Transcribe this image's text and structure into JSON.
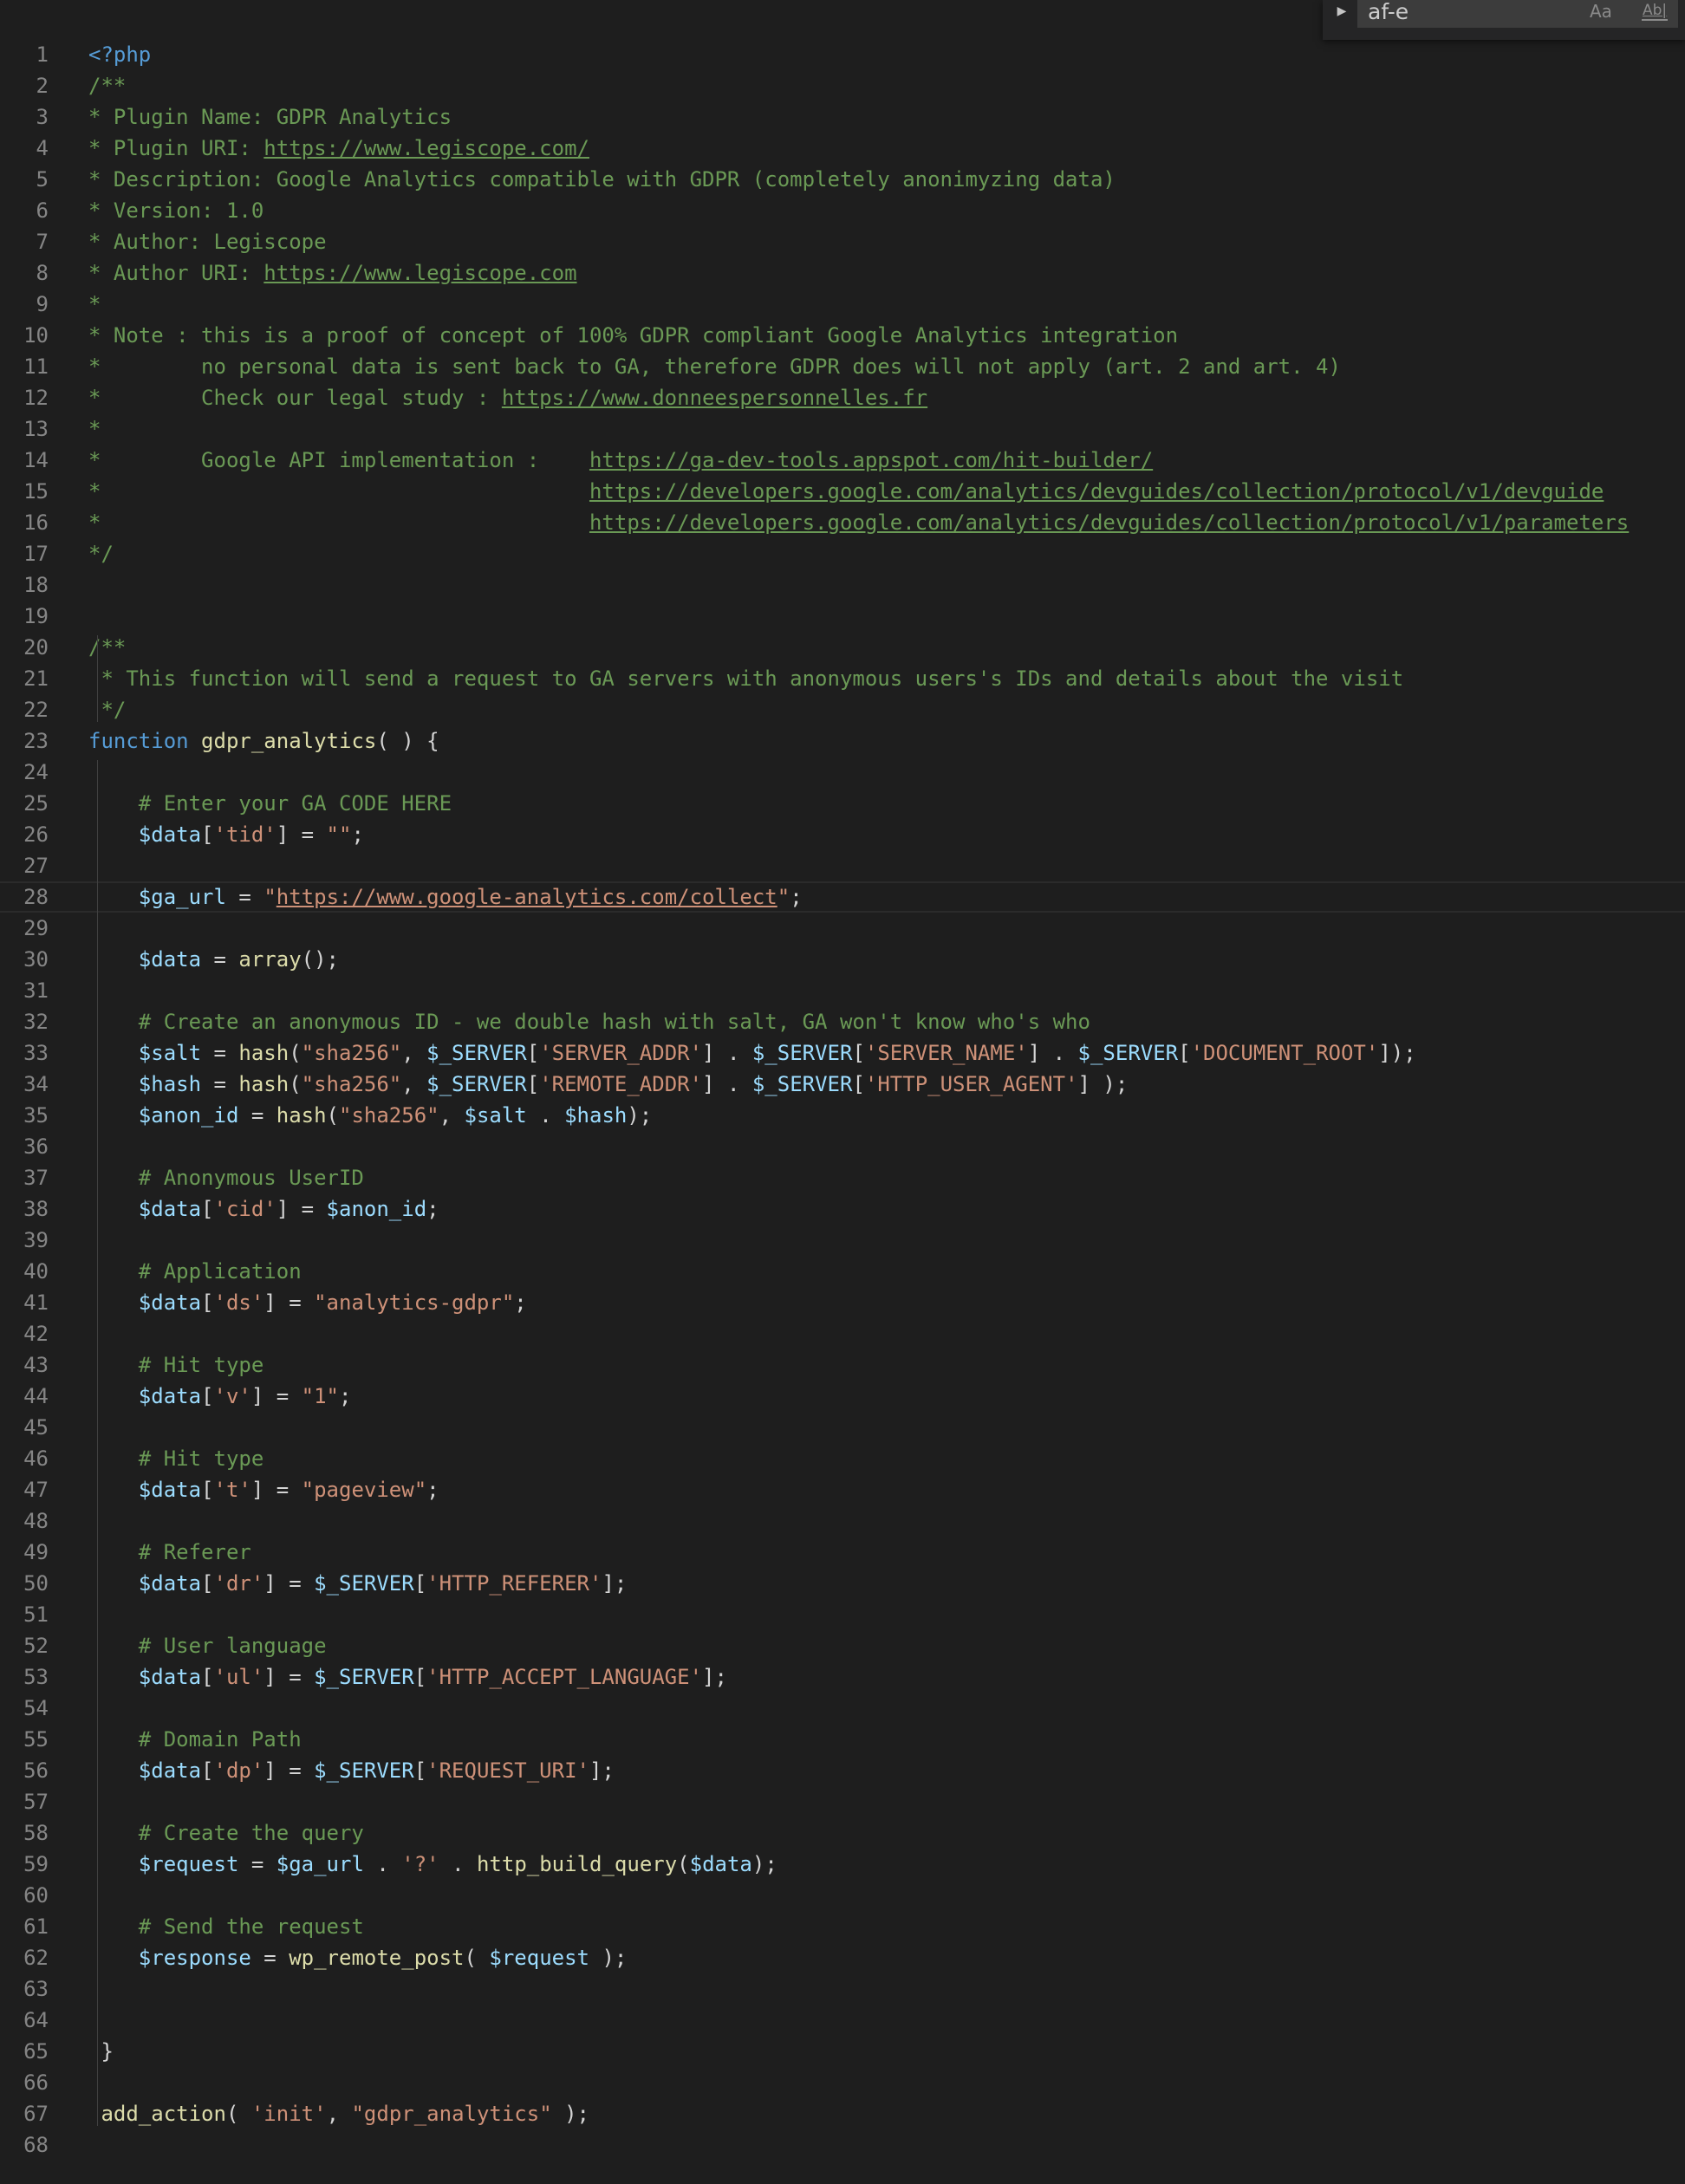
{
  "editor": {
    "language": "php",
    "current_line": 28,
    "lines": [
      [
        [
          "t-keyword",
          "<?php"
        ]
      ],
      [
        [
          "t-comment",
          "/**"
        ]
      ],
      [
        [
          "t-comment",
          "* Plugin Name: GDPR Analytics"
        ]
      ],
      [
        [
          "t-comment",
          "* Plugin URI: "
        ],
        [
          "t-comment t-link",
          "https://www.legiscope.com/"
        ]
      ],
      [
        [
          "t-comment",
          "* Description: Google Analytics compatible with GDPR (completely anonimyzing data)"
        ]
      ],
      [
        [
          "t-comment",
          "* Version: 1.0"
        ]
      ],
      [
        [
          "t-comment",
          "* Author: Legiscope"
        ]
      ],
      [
        [
          "t-comment",
          "* Author URI: "
        ],
        [
          "t-comment t-link",
          "https://www.legiscope.com"
        ]
      ],
      [
        [
          "t-comment",
          "*"
        ]
      ],
      [
        [
          "t-comment",
          "* Note : this is a proof of concept of 100% GDPR compliant Google Analytics integration"
        ]
      ],
      [
        [
          "t-comment",
          "*        no personal data is sent back to GA, therefore GDPR does will not apply (art. 2 and art. 4)"
        ]
      ],
      [
        [
          "t-comment",
          "*        Check our legal study : "
        ],
        [
          "t-comment t-link",
          "https://www.donneespersonnelles.fr"
        ]
      ],
      [
        [
          "t-comment",
          "*"
        ]
      ],
      [
        [
          "t-comment",
          "*        Google API implementation :    "
        ],
        [
          "t-comment t-link",
          "https://ga-dev-tools.appspot.com/hit-builder/"
        ]
      ],
      [
        [
          "t-comment",
          "*                                       "
        ],
        [
          "t-comment t-link",
          "https://developers.google.com/analytics/devguides/collection/protocol/v1/devguide"
        ]
      ],
      [
        [
          "t-comment",
          "*                                       "
        ],
        [
          "t-comment t-link",
          "https://developers.google.com/analytics/devguides/collection/protocol/v1/parameters"
        ]
      ],
      [
        [
          "t-comment",
          "*/"
        ]
      ],
      [],
      [],
      [
        [
          "t-comment",
          "/**"
        ]
      ],
      [
        [
          "t-comment",
          " * This function will send a request to GA servers with anonymous users's IDs and details about the visit"
        ]
      ],
      [
        [
          "t-comment",
          " */"
        ]
      ],
      [
        [
          "t-keyword",
          "function "
        ],
        [
          "t-func",
          "gdpr_analytics"
        ],
        [
          "t-plain",
          "( ) {"
        ]
      ],
      [],
      [
        [
          "t-plain",
          "    "
        ],
        [
          "t-comment",
          "# Enter your GA CODE HERE"
        ]
      ],
      [
        [
          "t-plain",
          "    "
        ],
        [
          "t-var",
          "$data"
        ],
        [
          "t-plain",
          "["
        ],
        [
          "t-string",
          "'tid'"
        ],
        [
          "t-plain",
          "] = "
        ],
        [
          "t-string",
          "\"\""
        ],
        [
          "t-plain",
          ";"
        ]
      ],
      [],
      [
        [
          "t-plain",
          "    "
        ],
        [
          "t-var",
          "$ga_url"
        ],
        [
          "t-plain",
          " = "
        ],
        [
          "t-string",
          "\""
        ],
        [
          "t-string t-link",
          "https://www.google-analytics.com/collect"
        ],
        [
          "t-string",
          "\""
        ],
        [
          "t-plain",
          ";"
        ]
      ],
      [],
      [
        [
          "t-plain",
          "    "
        ],
        [
          "t-var",
          "$data"
        ],
        [
          "t-plain",
          " = "
        ],
        [
          "t-func",
          "array"
        ],
        [
          "t-plain",
          "();"
        ]
      ],
      [],
      [
        [
          "t-plain",
          "    "
        ],
        [
          "t-comment",
          "# Create an anonymous ID - we double hash with salt, GA won't know who's who"
        ]
      ],
      [
        [
          "t-plain",
          "    "
        ],
        [
          "t-var",
          "$salt"
        ],
        [
          "t-plain",
          " = "
        ],
        [
          "t-func",
          "hash"
        ],
        [
          "t-plain",
          "("
        ],
        [
          "t-string",
          "\"sha256\""
        ],
        [
          "t-plain",
          ", "
        ],
        [
          "t-var",
          "$_SERVER"
        ],
        [
          "t-plain",
          "["
        ],
        [
          "t-string",
          "'SERVER_ADDR'"
        ],
        [
          "t-plain",
          "] . "
        ],
        [
          "t-var",
          "$_SERVER"
        ],
        [
          "t-plain",
          "["
        ],
        [
          "t-string",
          "'SERVER_NAME'"
        ],
        [
          "t-plain",
          "] . "
        ],
        [
          "t-var",
          "$_SERVER"
        ],
        [
          "t-plain",
          "["
        ],
        [
          "t-string",
          "'DOCUMENT_ROOT'"
        ],
        [
          "t-plain",
          "]);"
        ]
      ],
      [
        [
          "t-plain",
          "    "
        ],
        [
          "t-var",
          "$hash"
        ],
        [
          "t-plain",
          " = "
        ],
        [
          "t-func",
          "hash"
        ],
        [
          "t-plain",
          "("
        ],
        [
          "t-string",
          "\"sha256\""
        ],
        [
          "t-plain",
          ", "
        ],
        [
          "t-var",
          "$_SERVER"
        ],
        [
          "t-plain",
          "["
        ],
        [
          "t-string",
          "'REMOTE_ADDR'"
        ],
        [
          "t-plain",
          "] . "
        ],
        [
          "t-var",
          "$_SERVER"
        ],
        [
          "t-plain",
          "["
        ],
        [
          "t-string",
          "'HTTP_USER_AGENT'"
        ],
        [
          "t-plain",
          "] );"
        ]
      ],
      [
        [
          "t-plain",
          "    "
        ],
        [
          "t-var",
          "$anon_id"
        ],
        [
          "t-plain",
          " = "
        ],
        [
          "t-func",
          "hash"
        ],
        [
          "t-plain",
          "("
        ],
        [
          "t-string",
          "\"sha256\""
        ],
        [
          "t-plain",
          ", "
        ],
        [
          "t-var",
          "$salt"
        ],
        [
          "t-plain",
          " . "
        ],
        [
          "t-var",
          "$hash"
        ],
        [
          "t-plain",
          ");"
        ]
      ],
      [],
      [
        [
          "t-plain",
          "    "
        ],
        [
          "t-comment",
          "# Anonymous UserID"
        ]
      ],
      [
        [
          "t-plain",
          "    "
        ],
        [
          "t-var",
          "$data"
        ],
        [
          "t-plain",
          "["
        ],
        [
          "t-string",
          "'cid'"
        ],
        [
          "t-plain",
          "] = "
        ],
        [
          "t-var",
          "$anon_id"
        ],
        [
          "t-plain",
          ";"
        ]
      ],
      [],
      [
        [
          "t-plain",
          "    "
        ],
        [
          "t-comment",
          "# Application"
        ]
      ],
      [
        [
          "t-plain",
          "    "
        ],
        [
          "t-var",
          "$data"
        ],
        [
          "t-plain",
          "["
        ],
        [
          "t-string",
          "'ds'"
        ],
        [
          "t-plain",
          "] = "
        ],
        [
          "t-string",
          "\"analytics-gdpr\""
        ],
        [
          "t-plain",
          ";"
        ]
      ],
      [],
      [
        [
          "t-plain",
          "    "
        ],
        [
          "t-comment",
          "# Hit type"
        ]
      ],
      [
        [
          "t-plain",
          "    "
        ],
        [
          "t-var",
          "$data"
        ],
        [
          "t-plain",
          "["
        ],
        [
          "t-string",
          "'v'"
        ],
        [
          "t-plain",
          "] = "
        ],
        [
          "t-string",
          "\"1\""
        ],
        [
          "t-plain",
          ";"
        ]
      ],
      [],
      [
        [
          "t-plain",
          "    "
        ],
        [
          "t-comment",
          "# Hit type"
        ]
      ],
      [
        [
          "t-plain",
          "    "
        ],
        [
          "t-var",
          "$data"
        ],
        [
          "t-plain",
          "["
        ],
        [
          "t-string",
          "'t'"
        ],
        [
          "t-plain",
          "] = "
        ],
        [
          "t-string",
          "\"pageview\""
        ],
        [
          "t-plain",
          ";"
        ]
      ],
      [],
      [
        [
          "t-plain",
          "    "
        ],
        [
          "t-comment",
          "# Referer"
        ]
      ],
      [
        [
          "t-plain",
          "    "
        ],
        [
          "t-var",
          "$data"
        ],
        [
          "t-plain",
          "["
        ],
        [
          "t-string",
          "'dr'"
        ],
        [
          "t-plain",
          "] = "
        ],
        [
          "t-var",
          "$_SERVER"
        ],
        [
          "t-plain",
          "["
        ],
        [
          "t-string",
          "'HTTP_REFERER'"
        ],
        [
          "t-plain",
          "];"
        ]
      ],
      [],
      [
        [
          "t-plain",
          "    "
        ],
        [
          "t-comment",
          "# User language"
        ]
      ],
      [
        [
          "t-plain",
          "    "
        ],
        [
          "t-var",
          "$data"
        ],
        [
          "t-plain",
          "["
        ],
        [
          "t-string",
          "'ul'"
        ],
        [
          "t-plain",
          "] = "
        ],
        [
          "t-var",
          "$_SERVER"
        ],
        [
          "t-plain",
          "["
        ],
        [
          "t-string",
          "'HTTP_ACCEPT_LANGUAGE'"
        ],
        [
          "t-plain",
          "];"
        ]
      ],
      [],
      [
        [
          "t-plain",
          "    "
        ],
        [
          "t-comment",
          "# Domain Path"
        ]
      ],
      [
        [
          "t-plain",
          "    "
        ],
        [
          "t-var",
          "$data"
        ],
        [
          "t-plain",
          "["
        ],
        [
          "t-string",
          "'dp'"
        ],
        [
          "t-plain",
          "] = "
        ],
        [
          "t-var",
          "$_SERVER"
        ],
        [
          "t-plain",
          "["
        ],
        [
          "t-string",
          "'REQUEST_URI'"
        ],
        [
          "t-plain",
          "];"
        ]
      ],
      [],
      [
        [
          "t-plain",
          "    "
        ],
        [
          "t-comment",
          "# Create the query"
        ]
      ],
      [
        [
          "t-plain",
          "    "
        ],
        [
          "t-var",
          "$request"
        ],
        [
          "t-plain",
          " = "
        ],
        [
          "t-var",
          "$ga_url"
        ],
        [
          "t-plain",
          " . "
        ],
        [
          "t-string",
          "'?'"
        ],
        [
          "t-plain",
          " . "
        ],
        [
          "t-func",
          "http_build_query"
        ],
        [
          "t-plain",
          "("
        ],
        [
          "t-var",
          "$data"
        ],
        [
          "t-plain",
          ");"
        ]
      ],
      [],
      [
        [
          "t-plain",
          "    "
        ],
        [
          "t-comment",
          "# Send the request"
        ]
      ],
      [
        [
          "t-plain",
          "    "
        ],
        [
          "t-var",
          "$response"
        ],
        [
          "t-plain",
          " = "
        ],
        [
          "t-func",
          "wp_remote_post"
        ],
        [
          "t-plain",
          "( "
        ],
        [
          "t-var",
          "$request"
        ],
        [
          "t-plain",
          " );"
        ]
      ],
      [],
      [],
      [
        [
          "t-plain",
          " }"
        ]
      ],
      [],
      [
        [
          "t-plain",
          " "
        ],
        [
          "t-func",
          "add_action"
        ],
        [
          "t-plain",
          "( "
        ],
        [
          "t-string",
          "'init'"
        ],
        [
          "t-plain",
          ", "
        ],
        [
          "t-string",
          "\"gdpr_analytics\""
        ],
        [
          "t-plain",
          " );"
        ]
      ],
      []
    ]
  },
  "find_widget": {
    "query": "af-e",
    "match_case_label": "Aa",
    "whole_word_label": "Ab|",
    "colors": {
      "background": "#252526",
      "input": "#3c3c3c"
    }
  },
  "colors": {
    "background": "#1e1e1e",
    "line_number": "#858585",
    "comment": "#6a9955",
    "keyword": "#569cd6",
    "function": "#dcdcaa",
    "variable": "#9cdcfe",
    "string": "#ce9178"
  }
}
